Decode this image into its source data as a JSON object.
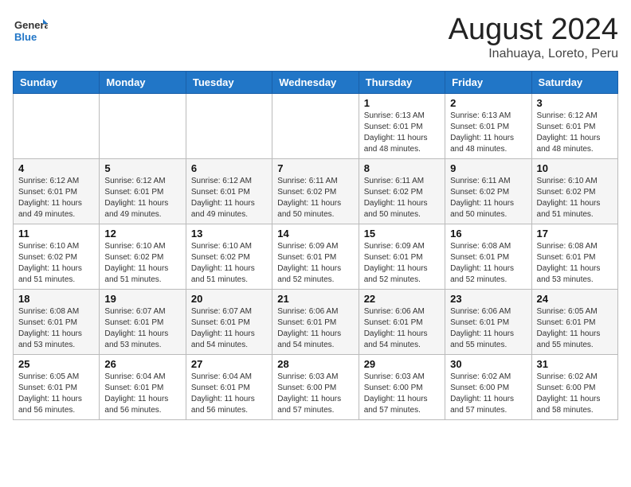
{
  "header": {
    "logo_general": "General",
    "logo_blue": "Blue",
    "title": "August 2024",
    "subtitle": "Inahuaya, Loreto, Peru"
  },
  "weekdays": [
    "Sunday",
    "Monday",
    "Tuesday",
    "Wednesday",
    "Thursday",
    "Friday",
    "Saturday"
  ],
  "weeks": [
    [
      {
        "day": "",
        "sunrise": "",
        "sunset": "",
        "daylight": ""
      },
      {
        "day": "",
        "sunrise": "",
        "sunset": "",
        "daylight": ""
      },
      {
        "day": "",
        "sunrise": "",
        "sunset": "",
        "daylight": ""
      },
      {
        "day": "",
        "sunrise": "",
        "sunset": "",
        "daylight": ""
      },
      {
        "day": "1",
        "sunrise": "Sunrise: 6:13 AM",
        "sunset": "Sunset: 6:01 PM",
        "daylight": "Daylight: 11 hours and 48 minutes."
      },
      {
        "day": "2",
        "sunrise": "Sunrise: 6:13 AM",
        "sunset": "Sunset: 6:01 PM",
        "daylight": "Daylight: 11 hours and 48 minutes."
      },
      {
        "day": "3",
        "sunrise": "Sunrise: 6:12 AM",
        "sunset": "Sunset: 6:01 PM",
        "daylight": "Daylight: 11 hours and 48 minutes."
      }
    ],
    [
      {
        "day": "4",
        "sunrise": "Sunrise: 6:12 AM",
        "sunset": "Sunset: 6:01 PM",
        "daylight": "Daylight: 11 hours and 49 minutes."
      },
      {
        "day": "5",
        "sunrise": "Sunrise: 6:12 AM",
        "sunset": "Sunset: 6:01 PM",
        "daylight": "Daylight: 11 hours and 49 minutes."
      },
      {
        "day": "6",
        "sunrise": "Sunrise: 6:12 AM",
        "sunset": "Sunset: 6:01 PM",
        "daylight": "Daylight: 11 hours and 49 minutes."
      },
      {
        "day": "7",
        "sunrise": "Sunrise: 6:11 AM",
        "sunset": "Sunset: 6:02 PM",
        "daylight": "Daylight: 11 hours and 50 minutes."
      },
      {
        "day": "8",
        "sunrise": "Sunrise: 6:11 AM",
        "sunset": "Sunset: 6:02 PM",
        "daylight": "Daylight: 11 hours and 50 minutes."
      },
      {
        "day": "9",
        "sunrise": "Sunrise: 6:11 AM",
        "sunset": "Sunset: 6:02 PM",
        "daylight": "Daylight: 11 hours and 50 minutes."
      },
      {
        "day": "10",
        "sunrise": "Sunrise: 6:10 AM",
        "sunset": "Sunset: 6:02 PM",
        "daylight": "Daylight: 11 hours and 51 minutes."
      }
    ],
    [
      {
        "day": "11",
        "sunrise": "Sunrise: 6:10 AM",
        "sunset": "Sunset: 6:02 PM",
        "daylight": "Daylight: 11 hours and 51 minutes."
      },
      {
        "day": "12",
        "sunrise": "Sunrise: 6:10 AM",
        "sunset": "Sunset: 6:02 PM",
        "daylight": "Daylight: 11 hours and 51 minutes."
      },
      {
        "day": "13",
        "sunrise": "Sunrise: 6:10 AM",
        "sunset": "Sunset: 6:02 PM",
        "daylight": "Daylight: 11 hours and 51 minutes."
      },
      {
        "day": "14",
        "sunrise": "Sunrise: 6:09 AM",
        "sunset": "Sunset: 6:01 PM",
        "daylight": "Daylight: 11 hours and 52 minutes."
      },
      {
        "day": "15",
        "sunrise": "Sunrise: 6:09 AM",
        "sunset": "Sunset: 6:01 PM",
        "daylight": "Daylight: 11 hours and 52 minutes."
      },
      {
        "day": "16",
        "sunrise": "Sunrise: 6:08 AM",
        "sunset": "Sunset: 6:01 PM",
        "daylight": "Daylight: 11 hours and 52 minutes."
      },
      {
        "day": "17",
        "sunrise": "Sunrise: 6:08 AM",
        "sunset": "Sunset: 6:01 PM",
        "daylight": "Daylight: 11 hours and 53 minutes."
      }
    ],
    [
      {
        "day": "18",
        "sunrise": "Sunrise: 6:08 AM",
        "sunset": "Sunset: 6:01 PM",
        "daylight": "Daylight: 11 hours and 53 minutes."
      },
      {
        "day": "19",
        "sunrise": "Sunrise: 6:07 AM",
        "sunset": "Sunset: 6:01 PM",
        "daylight": "Daylight: 11 hours and 53 minutes."
      },
      {
        "day": "20",
        "sunrise": "Sunrise: 6:07 AM",
        "sunset": "Sunset: 6:01 PM",
        "daylight": "Daylight: 11 hours and 54 minutes."
      },
      {
        "day": "21",
        "sunrise": "Sunrise: 6:06 AM",
        "sunset": "Sunset: 6:01 PM",
        "daylight": "Daylight: 11 hours and 54 minutes."
      },
      {
        "day": "22",
        "sunrise": "Sunrise: 6:06 AM",
        "sunset": "Sunset: 6:01 PM",
        "daylight": "Daylight: 11 hours and 54 minutes."
      },
      {
        "day": "23",
        "sunrise": "Sunrise: 6:06 AM",
        "sunset": "Sunset: 6:01 PM",
        "daylight": "Daylight: 11 hours and 55 minutes."
      },
      {
        "day": "24",
        "sunrise": "Sunrise: 6:05 AM",
        "sunset": "Sunset: 6:01 PM",
        "daylight": "Daylight: 11 hours and 55 minutes."
      }
    ],
    [
      {
        "day": "25",
        "sunrise": "Sunrise: 6:05 AM",
        "sunset": "Sunset: 6:01 PM",
        "daylight": "Daylight: 11 hours and 56 minutes."
      },
      {
        "day": "26",
        "sunrise": "Sunrise: 6:04 AM",
        "sunset": "Sunset: 6:01 PM",
        "daylight": "Daylight: 11 hours and 56 minutes."
      },
      {
        "day": "27",
        "sunrise": "Sunrise: 6:04 AM",
        "sunset": "Sunset: 6:01 PM",
        "daylight": "Daylight: 11 hours and 56 minutes."
      },
      {
        "day": "28",
        "sunrise": "Sunrise: 6:03 AM",
        "sunset": "Sunset: 6:00 PM",
        "daylight": "Daylight: 11 hours and 57 minutes."
      },
      {
        "day": "29",
        "sunrise": "Sunrise: 6:03 AM",
        "sunset": "Sunset: 6:00 PM",
        "daylight": "Daylight: 11 hours and 57 minutes."
      },
      {
        "day": "30",
        "sunrise": "Sunrise: 6:02 AM",
        "sunset": "Sunset: 6:00 PM",
        "daylight": "Daylight: 11 hours and 57 minutes."
      },
      {
        "day": "31",
        "sunrise": "Sunrise: 6:02 AM",
        "sunset": "Sunset: 6:00 PM",
        "daylight": "Daylight: 11 hours and 58 minutes."
      }
    ]
  ]
}
